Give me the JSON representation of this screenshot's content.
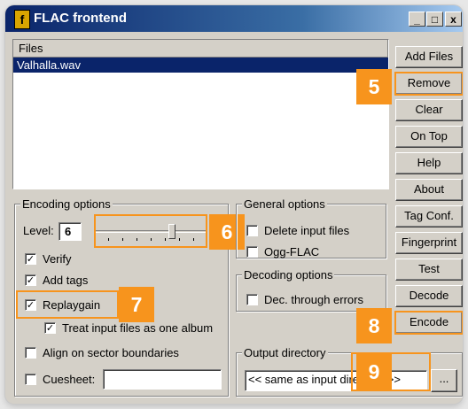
{
  "window": {
    "title": "FLAC frontend",
    "icon_letter": "f"
  },
  "titlebar_buttons": {
    "minimize": "_",
    "maximize": "□",
    "close": "x"
  },
  "files": {
    "header": "Files",
    "items": [
      "Valhalla.wav"
    ]
  },
  "side_buttons": [
    "Add Files",
    "Remove",
    "Clear",
    "On Top",
    "Help",
    "About",
    "Tag Conf.",
    "Fingerprint",
    "Test",
    "Decode",
    "Encode"
  ],
  "encoding_options": {
    "legend": "Encoding options",
    "level_label": "Level:",
    "level_value": "6",
    "verify_label": "Verify",
    "verify_checked": true,
    "add_tags_label": "Add tags",
    "add_tags_checked": true,
    "replaygain_label": "Replaygain",
    "replaygain_checked": true,
    "treat_album_label": "Treat input files as one album",
    "treat_album_checked": true,
    "align_label": "Align on sector boundaries",
    "align_checked": false,
    "cuesheet_label": "Cuesheet:",
    "cuesheet_value": ""
  },
  "general_options": {
    "legend": "General options",
    "delete_label": "Delete input files",
    "delete_checked": false,
    "ogg_label": "Ogg-FLAC",
    "ogg_checked": false
  },
  "decoding_options": {
    "legend": "Decoding options",
    "dec_errors_label": "Dec. through errors",
    "dec_errors_checked": false
  },
  "output_directory": {
    "legend": "Output directory",
    "value": "<< same as input directory >>",
    "browse_label": "..."
  },
  "callouts": [
    "5",
    "6",
    "7",
    "8",
    "9"
  ],
  "colors": {
    "callout": "#f7941d",
    "selection": "#0a246a",
    "face": "#d4d0c8"
  }
}
